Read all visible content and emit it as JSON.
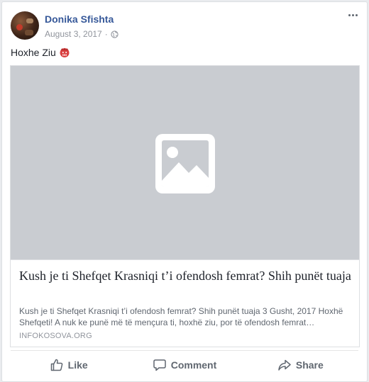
{
  "post": {
    "author": "Donika Sfishta",
    "date": "August 3, 2017",
    "separator": "·",
    "privacy_icon": "globe-icon",
    "more_icon": "more-options-icon",
    "text": "Hoxhe Ziu",
    "emoji_icon": "angry-face-emoji"
  },
  "link": {
    "image_icon": "image-placeholder-icon",
    "title": "Kush je ti Shefqet Krasniqi t’i ofendosh femrat? Shih punët tuaja",
    "description": "Kush je ti Shefqet Krasniqi t’i ofendosh femrat? Shih punët tuaja 3 Gusht, 2017 Hoxhë Shefqeti! A nuk ke punë më të mençura ti, hoxhë ziu, por të ofendosh femrat…",
    "domain": "INFOKOSOVA.ORG"
  },
  "actions": {
    "like_label": "Like",
    "comment_label": "Comment",
    "share_label": "Share"
  },
  "colors": {
    "author_link": "#365899",
    "image_placeholder": "#c9ccd1",
    "action_text": "#606770"
  }
}
